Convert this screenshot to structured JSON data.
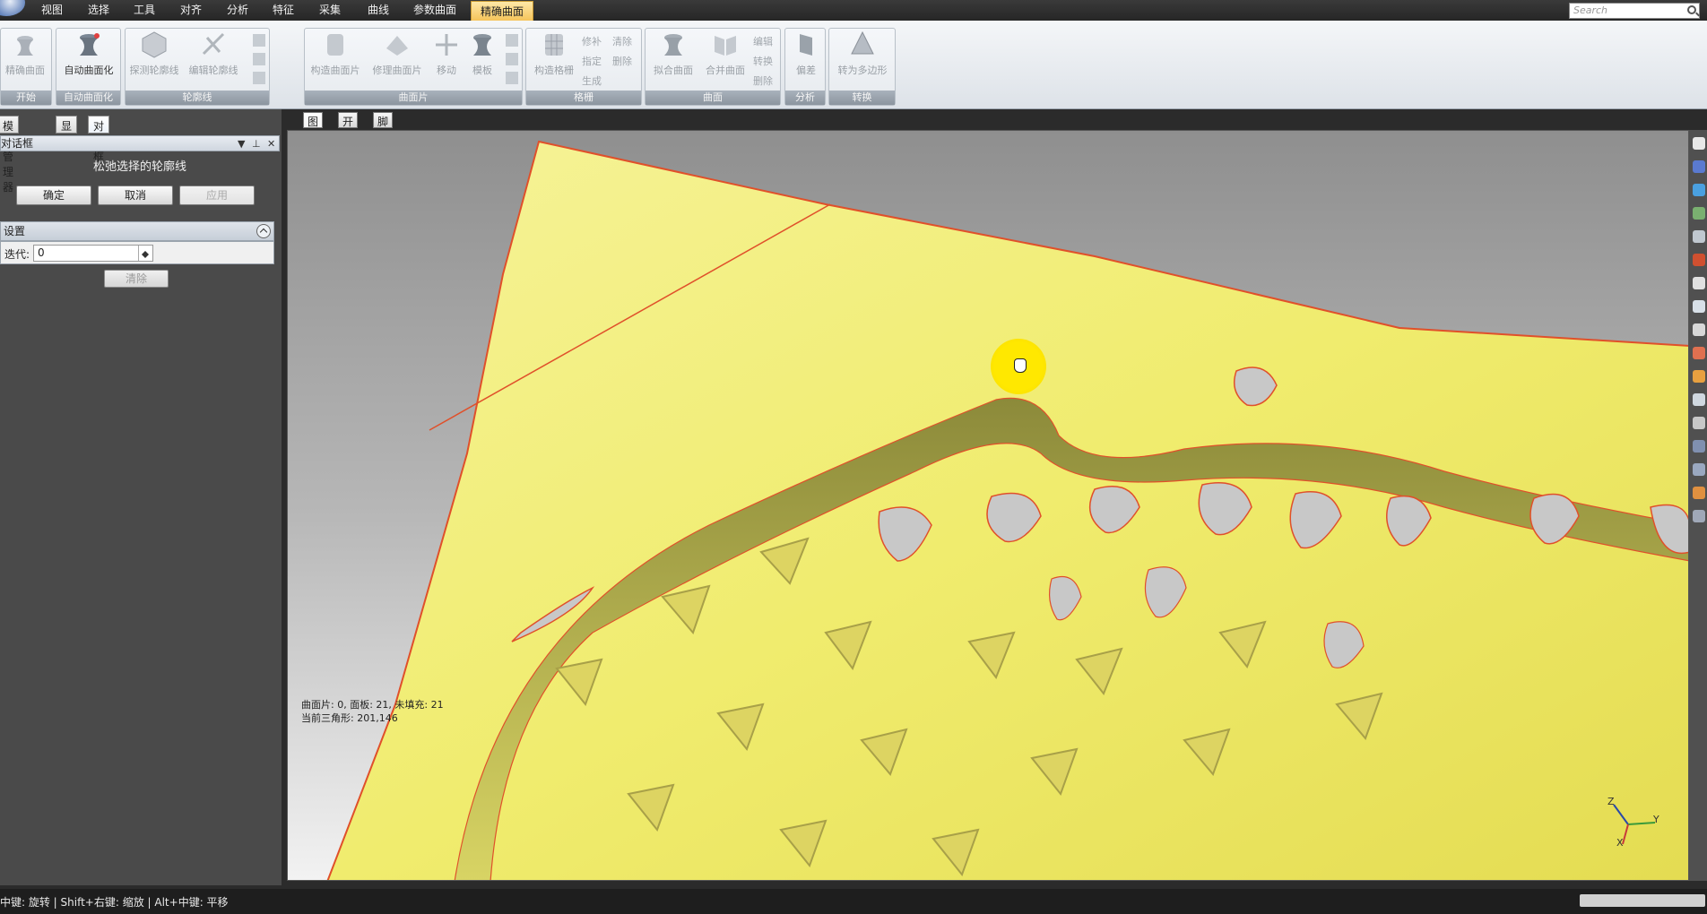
{
  "menu": [
    "视图",
    "选择",
    "工具",
    "对齐",
    "分析",
    "特征",
    "采集",
    "曲线",
    "参数曲面",
    "精确曲面"
  ],
  "search": {
    "placeholder": "Search"
  },
  "ribbon": {
    "groups": [
      {
        "title": "开始",
        "buttons": [
          "精确曲面"
        ]
      },
      {
        "title": "自动曲面化",
        "buttons": [
          "自动曲面化"
        ]
      },
      {
        "title": "轮廓线",
        "buttons": [
          "探测轮廓线",
          "编辑轮廓线"
        ]
      },
      {
        "title": "曲面片",
        "buttons": [
          "构造曲面片",
          "修理曲面片",
          "移动",
          "模板"
        ]
      },
      {
        "title": "格栅",
        "buttons": [
          "构造格栅"
        ],
        "small": [
          "修补",
          "清除",
          "指定",
          "删除",
          "生成"
        ]
      },
      {
        "title": "曲面",
        "buttons": [
          "拟合曲面",
          "合并曲面"
        ],
        "small": [
          "编辑",
          "转换",
          "删除"
        ]
      },
      {
        "title": "分析",
        "buttons": [
          "偏差"
        ]
      },
      {
        "title": "转换",
        "buttons": [
          "转为多边形"
        ]
      }
    ]
  },
  "panel": {
    "tabs": [
      "模型管理器",
      "显示",
      "对话框"
    ],
    "bar_title": "对话框",
    "dialog_title": "松弛选择的轮廓线",
    "ok": "确定",
    "cancel": "取消",
    "apply": "应用",
    "settings": "设置",
    "iter_label": "迭代:",
    "iter_value": "0",
    "clear": "清除"
  },
  "view_tabs": [
    "图形",
    "开始",
    "脚本"
  ],
  "viewport": {
    "info_line1": "曲面片: 0, 面板: 21, 未填充: 21",
    "info_line2": "当前三角形: 201,146",
    "axis": {
      "z": "Z",
      "y": "Y",
      "x": "X"
    }
  },
  "status": "中键: 旋转 | Shift+右键: 缩放 | Alt+中键: 平移",
  "colors": {
    "surface": "#f2ef7a",
    "contour": "#e0502a",
    "highlight": "#ffe800"
  }
}
